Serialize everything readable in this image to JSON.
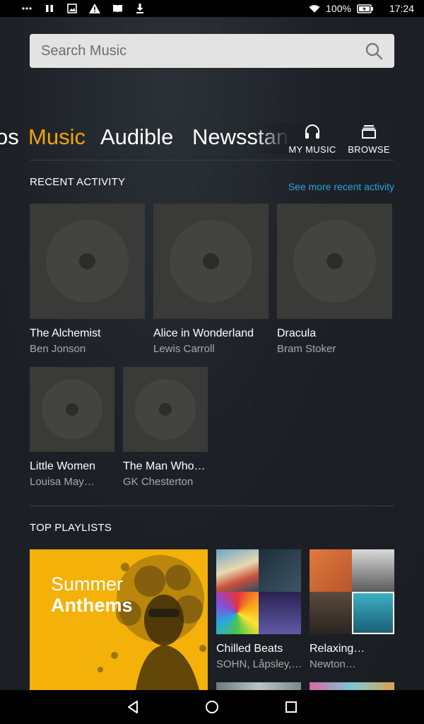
{
  "status_bar": {
    "battery": "100%",
    "time": "17:24"
  },
  "search": {
    "placeholder": "Search Music"
  },
  "tabs": {
    "partial_left": "os",
    "music": "Music",
    "audible": "Audible",
    "newsstand": "Newsstan"
  },
  "nav_buttons": {
    "my_music": "MY MUSIC",
    "browse": "BROWSE"
  },
  "recent_activity": {
    "title": "RECENT ACTIVITY",
    "see_more": "See more recent activity",
    "items": [
      {
        "title": "The Alchemist",
        "author": "Ben Jonson"
      },
      {
        "title": "Alice in Wonderland",
        "author": "Lewis Carroll"
      },
      {
        "title": "Dracula",
        "author": "Bram Stoker"
      },
      {
        "title": "Little Women",
        "author": "Louisa May…"
      },
      {
        "title": "The Man Who…",
        "author": "GK Chesterton"
      }
    ]
  },
  "top_playlists": {
    "title": "TOP PLAYLISTS",
    "featured": {
      "line1": "Summer",
      "line2": "Anthems"
    },
    "items": [
      {
        "title": "Chilled Beats",
        "artists": "SOHN, Låpsley,…"
      },
      {
        "title": "Relaxing…",
        "artists": "Newton…"
      }
    ]
  },
  "colors": {
    "accent": "#f0a500",
    "link": "#2aa5e0",
    "background": "#1b1f24"
  }
}
